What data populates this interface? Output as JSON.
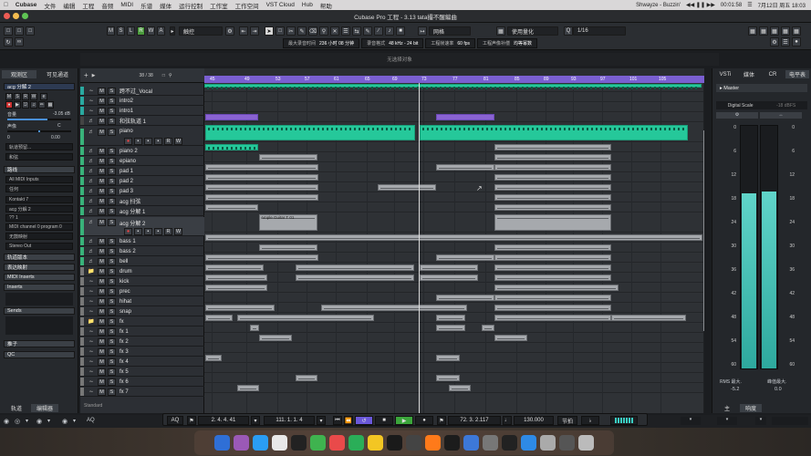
{
  "menubar": {
    "items": [
      "Cubase",
      "文件",
      "编辑",
      "工程",
      "音频",
      "MIDI",
      "乐谱",
      "媒体",
      "运行控制",
      "工作室",
      "工作空间",
      "VST Cloud",
      "Hub",
      "帮助"
    ],
    "now_playing": "Shwayze - Buzzin'",
    "time_display": "00:01:58",
    "clock": "7月12日 周五 18:03"
  },
  "window": {
    "title": "Cubase Pro 工程 - 3.13 tata撮不醒編曲"
  },
  "toolbar": {
    "ms_labels": [
      "M",
      "S",
      "L",
      "R",
      "W",
      "A"
    ],
    "touch_mode": "触控",
    "grid_type": "网格",
    "quantize_mode": "使用量化",
    "quantize_value": "1/16",
    "info": [
      {
        "label": "最大录音时间",
        "value": "236 小时 08 分钟"
      },
      {
        "label": "录音格式",
        "value": "48 kHz - 24 bit"
      },
      {
        "label": "工程帧速率",
        "value": "60 fps"
      },
      {
        "label": "工程声像补偿",
        "value": "均等幂数"
      }
    ]
  },
  "selection_bar": {
    "text": "无选择对象"
  },
  "inspector": {
    "tabs": [
      "观测区",
      "可见通道"
    ],
    "track_name": "acg 分解 2",
    "volume_label": "音量",
    "volume_value": "-3.05 dB",
    "pan_label": "声像",
    "pan_value": "0.00",
    "pan_side": "C",
    "extra_value": "0",
    "automation_label": "轨道预留...",
    "chord_label": "和弦",
    "routing_label": "路线",
    "input_label": "All MIDI Inputs",
    "any_label": "任何",
    "instrument": "Kontakt 7",
    "output_sub": "acg 分解 2",
    "channel": "?? 1",
    "program": "MIDI channel 0 program 0",
    "drum_map": "无鼓映射",
    "stereo_out": "Stereo Out",
    "sections": [
      "轨道版本",
      "表达映射",
      "MIDI Inserts",
      "Inserts",
      "Sends",
      "推子",
      "QC"
    ],
    "bottom_tabs": [
      "轨道",
      "编辑器"
    ]
  },
  "tracklist": {
    "header": {
      "count": "38 / 38"
    },
    "tracks": [
      {
        "name": "跨不过_Vocal",
        "icon": "audio"
      },
      {
        "name": "intro2",
        "icon": "audio"
      },
      {
        "name": "intro1",
        "icon": "audio"
      },
      {
        "name": "和弦轨道 1",
        "icon": "chord"
      },
      {
        "name": "piano",
        "icon": "midi"
      },
      {
        "name": "piano 2",
        "icon": "midi"
      },
      {
        "name": "epiano",
        "icon": "midi"
      },
      {
        "name": "pad 1",
        "icon": "midi"
      },
      {
        "name": "pad 2",
        "icon": "midi"
      },
      {
        "name": "pad 3",
        "icon": "midi"
      },
      {
        "name": "acg 扫弦",
        "icon": "midi"
      },
      {
        "name": "acg 分解 1",
        "icon": "midi"
      },
      {
        "name": "acg 分解 2",
        "icon": "midi"
      },
      {
        "name": "bass 1",
        "icon": "midi"
      },
      {
        "name": "bass 2",
        "icon": "midi"
      },
      {
        "name": "bell",
        "icon": "midi"
      },
      {
        "name": "drum",
        "icon": "folder"
      },
      {
        "name": "kick",
        "icon": "audio"
      },
      {
        "name": "prec",
        "icon": "audio"
      },
      {
        "name": "hihat",
        "icon": "audio"
      },
      {
        "name": "snap",
        "icon": "audio"
      },
      {
        "name": "fx",
        "icon": "folder"
      },
      {
        "name": "fx 1",
        "icon": "audio"
      },
      {
        "name": "fx 2",
        "icon": "audio"
      },
      {
        "name": "fx 3",
        "icon": "audio"
      },
      {
        "name": "fx 4",
        "icon": "audio"
      },
      {
        "name": "fx 5",
        "icon": "audio"
      },
      {
        "name": "fx 6",
        "icon": "audio"
      },
      {
        "name": "fx 7",
        "icon": "audio"
      }
    ],
    "footer": "Standard"
  },
  "ruler": {
    "labels": [
      "45",
      "49",
      "53",
      "57",
      "61",
      "65",
      "69",
      "73",
      "77",
      "81",
      "85",
      "89",
      "93",
      "97",
      "101",
      "105",
      "109",
      "113",
      "117",
      "120"
    ]
  },
  "clip_labels": {
    "acg2": "Ample Guitar T 01"
  },
  "rightzone": {
    "tabs": [
      "VSTi",
      "媒体",
      "CR",
      "电平表"
    ],
    "master": "Master",
    "digital_scale": "Digital Scale",
    "digital_value": "-18 dBFS",
    "scale_marks": [
      "0",
      "6",
      "12",
      "18",
      "24",
      "30",
      "36",
      "42",
      "48",
      "54",
      "60"
    ],
    "rms_label": "RMS 最大.",
    "peak_label": "峰值最大.",
    "rms_value": "-5.2",
    "peak_value": "0.0",
    "bottom_tabs": [
      "主",
      "响度"
    ]
  },
  "transport": {
    "aq": "AQ",
    "left_locator": "2. 4. 4. 41",
    "position": "111. 1. 1. 4",
    "right_locator": "72. 3. 2.117",
    "tempo": "130.000",
    "signature": "节拍",
    "status_aq": "AQ"
  },
  "colors": {
    "ruler": "#7a5fd1",
    "teal": "#25c89a",
    "purple": "#8a63d2",
    "meter": "#4bc7bb"
  },
  "meter": {
    "left_level": 0.72,
    "right_level": 0.73
  }
}
